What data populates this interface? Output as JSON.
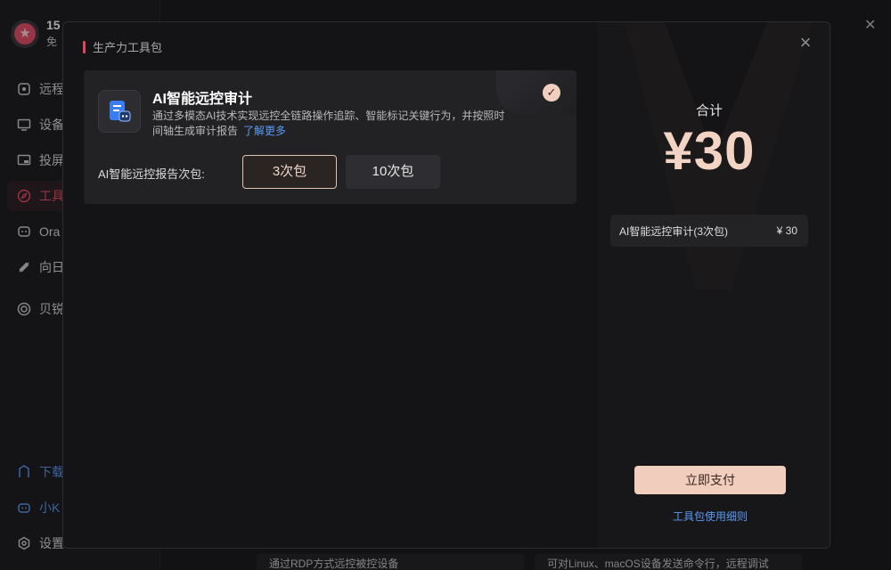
{
  "background": {
    "profile": {
      "name": "15",
      "sub": "免"
    },
    "nav": [
      {
        "label": "远程",
        "icon": "remote-icon"
      },
      {
        "label": "设备",
        "icon": "monitor-icon"
      },
      {
        "label": "投屏",
        "icon": "cast-icon"
      },
      {
        "label": "工具",
        "icon": "compass-icon",
        "active": true
      },
      {
        "label": "Ora",
        "icon": "ora-icon"
      },
      {
        "label": "向日",
        "icon": "sunflower-icon"
      },
      {
        "label": "贝锐",
        "icon": "circle-icon"
      }
    ],
    "bottom_nav": [
      {
        "label": "下载",
        "icon": "download-icon"
      },
      {
        "label": "小K",
        "icon": "robot-icon"
      },
      {
        "label": "设置",
        "icon": "settings-icon"
      }
    ],
    "bottom_strip_1": "通过RDP方式远控被控设备",
    "bottom_strip_2": "可对Linux、macOS设备发送命令行，远程调试"
  },
  "modal": {
    "title": "生产力工具包",
    "product": {
      "name": "AI智能远控审计",
      "description": "通过多模态AI技术实现远控全链路操作追踪、智能标记关键行为，并按照时间轴生成审计报告",
      "learn_more": "了解更多",
      "package_label": "AI智能远控报告次包:",
      "packages": [
        "3次包",
        "10次包"
      ],
      "selected_package": "3次包"
    },
    "summary": {
      "total_label": "合计",
      "total_price": "¥30",
      "line_item_name": "AI智能远控审计(3次包)",
      "line_item_price": "¥ 30"
    },
    "pay_button": "立即支付",
    "rules_link": "工具包使用细则"
  },
  "colors": {
    "accent": "#e0445f",
    "price": "#f3d3c4",
    "pay_button": "#f1cdbd",
    "link": "#5b9bf3"
  }
}
